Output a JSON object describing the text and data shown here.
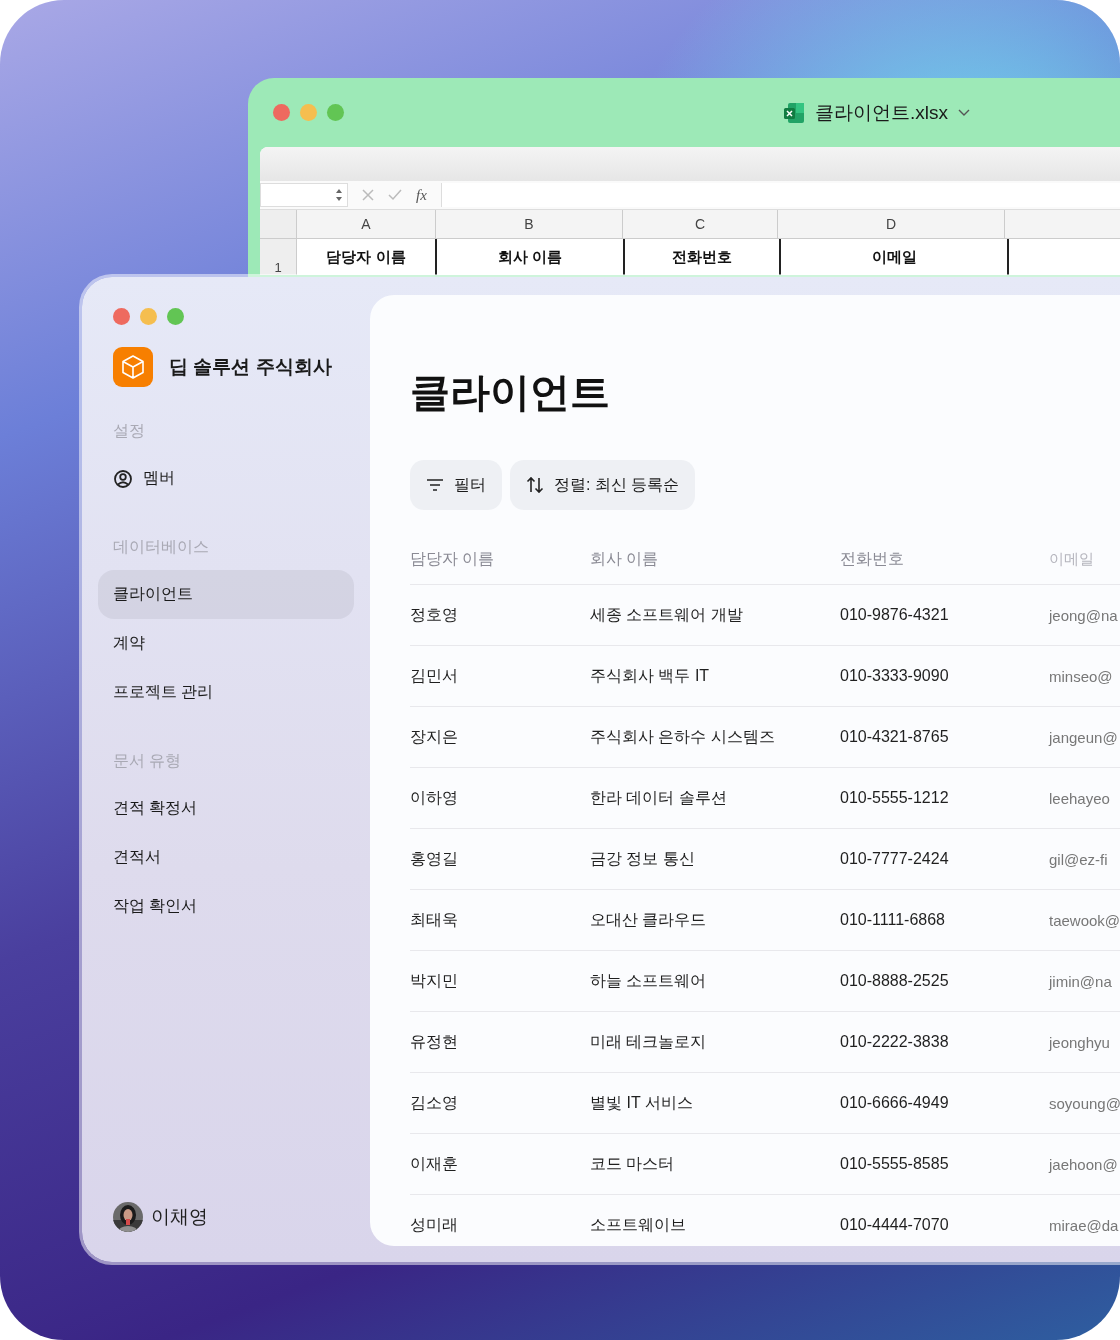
{
  "spreadsheet_window": {
    "title": "클라이언트.xlsx",
    "formula_label": "fx",
    "column_letters": [
      "A",
      "B",
      "C",
      "D"
    ],
    "row_number": "1",
    "header_cells": [
      "담당자 이름",
      "회사 이름",
      "전화번호",
      "이메일"
    ]
  },
  "sidebar": {
    "company": "딥 솔루션 주식회사",
    "sections": [
      {
        "heading": "설정",
        "items": [
          {
            "label": "멤버",
            "kind": "member",
            "selected": false
          }
        ]
      },
      {
        "heading": "데이터베이스",
        "items": [
          {
            "label": "클라이언트",
            "kind": "plain",
            "selected": true
          },
          {
            "label": "계약",
            "kind": "plain",
            "selected": false
          },
          {
            "label": "프로젝트 관리",
            "kind": "plain",
            "selected": false
          }
        ]
      },
      {
        "heading": "문서 유형",
        "items": [
          {
            "label": "견적 확정서",
            "kind": "plain",
            "selected": false
          },
          {
            "label": "견적서",
            "kind": "plain",
            "selected": false
          },
          {
            "label": "작업 확인서",
            "kind": "plain",
            "selected": false
          }
        ]
      }
    ],
    "user": {
      "name": "이채영"
    }
  },
  "page": {
    "title": "클라이언트",
    "toolbar": [
      {
        "label": "필터",
        "kind": "filter"
      },
      {
        "label": "정렬: 최신 등록순",
        "kind": "sort"
      }
    ],
    "table": {
      "columns": [
        "담당자 이름",
        "회사 이름",
        "전화번호",
        "이메일"
      ],
      "rows": [
        [
          "정호영",
          "세종 소프트웨어 개발",
          "010-9876-4321",
          "jeong@na"
        ],
        [
          "김민서",
          "주식회사 백두 IT",
          "010-3333-9090",
          "minseo@"
        ],
        [
          "장지은",
          "주식회사 은하수 시스템즈",
          "010-4321-8765",
          "jangeun@"
        ],
        [
          "이하영",
          "한라 데이터 솔루션",
          "010-5555-1212",
          "leehayeo"
        ],
        [
          "홍영길",
          "금강 정보 통신",
          "010-7777-2424",
          "gil@ez-fi"
        ],
        [
          "최태욱",
          "오대산 클라우드",
          "010-1111-6868",
          "taewook@"
        ],
        [
          "박지민",
          "하늘 소프트웨어",
          "010-8888-2525",
          "jimin@na"
        ],
        [
          "유정현",
          "미래 테크놀로지",
          "010-2222-3838",
          "jeonghyu"
        ],
        [
          "김소영",
          "별빛 IT 서비스",
          "010-6666-4949",
          "soyoung@"
        ],
        [
          "이재훈",
          "코드 마스터",
          "010-5555-8585",
          "jaehoon@"
        ],
        [
          "성미래",
          "소프트웨이브",
          "010-4444-7070",
          "mirae@da"
        ]
      ]
    }
  }
}
